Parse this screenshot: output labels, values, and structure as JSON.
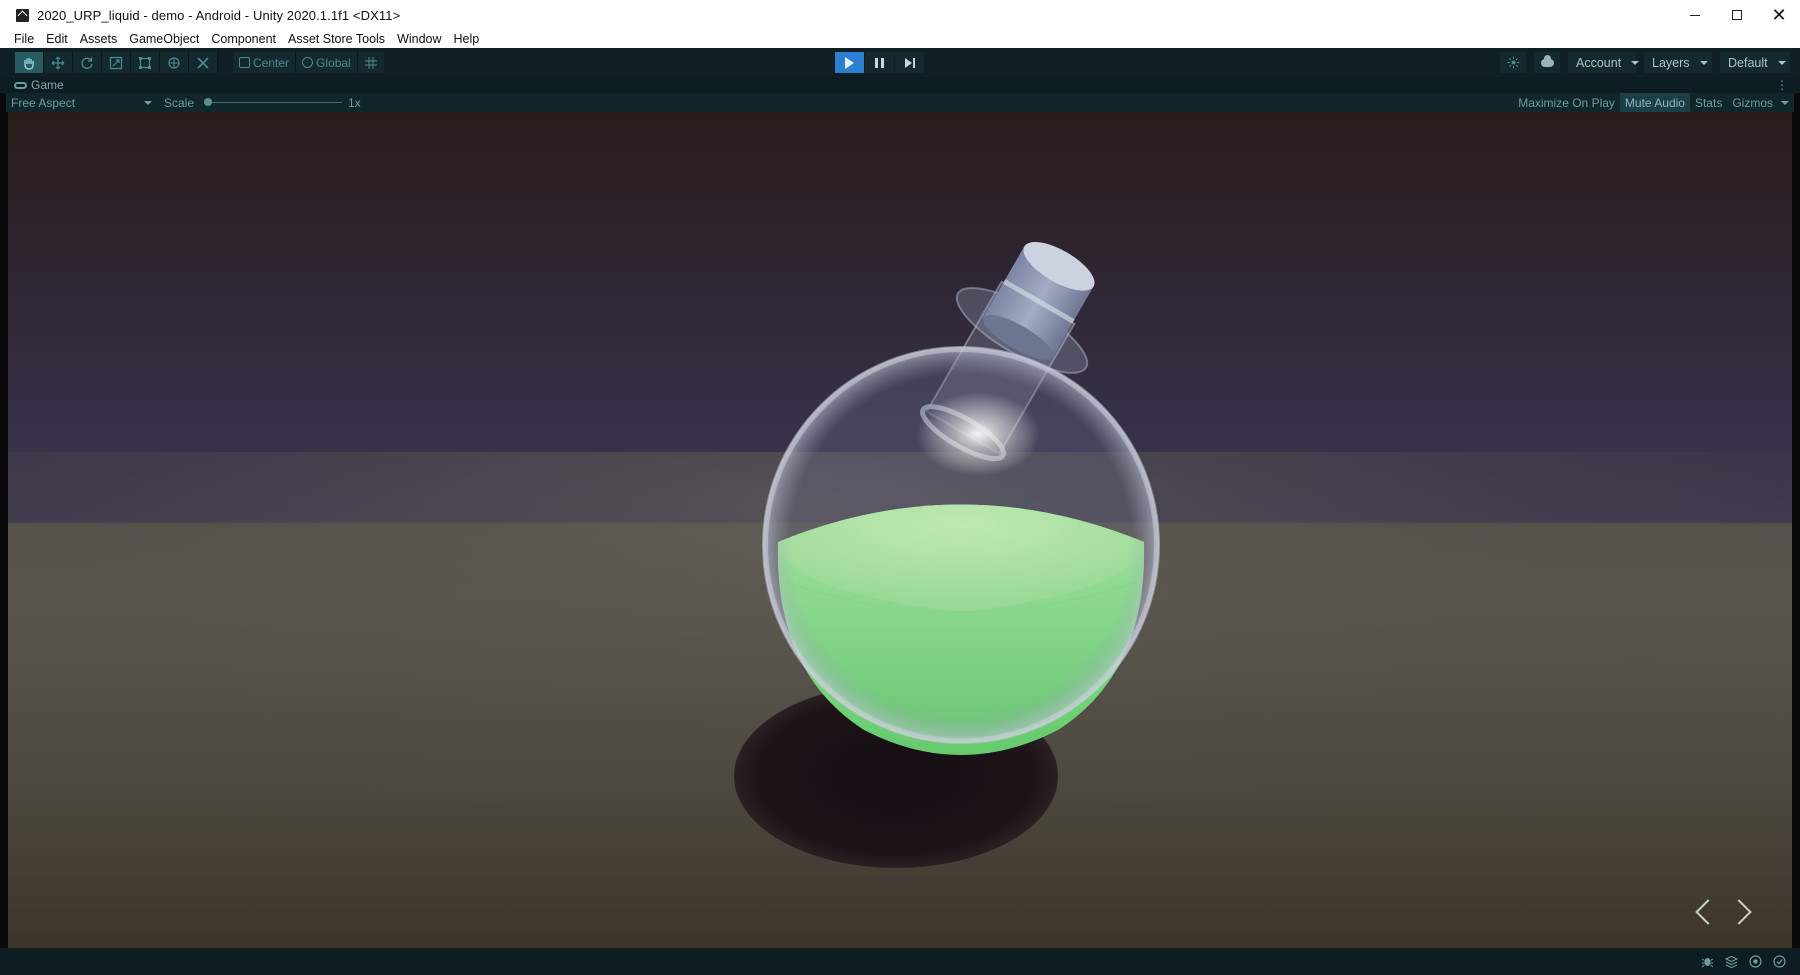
{
  "window": {
    "title": "2020_URP_liquid - demo - Android - Unity 2020.1.1f1 <DX11>",
    "controls": {
      "minimize": "—",
      "maximize": "☐",
      "close": "✕"
    }
  },
  "menu": {
    "items": [
      "File",
      "Edit",
      "Assets",
      "GameObject",
      "Component",
      "Asset Store Tools",
      "Window",
      "Help"
    ]
  },
  "toolbar": {
    "transform_tools": [
      "hand-tool",
      "move-tool",
      "rotate-tool",
      "scale-tool",
      "rect-tool",
      "transform-tool",
      "custom-tool"
    ],
    "active_tool": "hand-tool",
    "pivot_label": "Center",
    "space_label": "Global",
    "play_state": "playing",
    "account_label": "Account",
    "layers_label": "Layers",
    "layout_label": "Default"
  },
  "game_view": {
    "tab_label": "Game",
    "aspect_label": "Free Aspect",
    "scale_label": "Scale",
    "scale_value": "1x",
    "scale_fraction": 0,
    "maximize_label": "Maximize On Play",
    "mute_label": "Mute Audio",
    "mute_on": true,
    "stats_label": "Stats",
    "gizmos_label": "Gizmos",
    "liquid_color": "#7de07f"
  },
  "colors": {
    "play_active": "#2c7fd0",
    "toolbar_bg": "#0f1f24",
    "accent_teal": "#4a8a93"
  }
}
